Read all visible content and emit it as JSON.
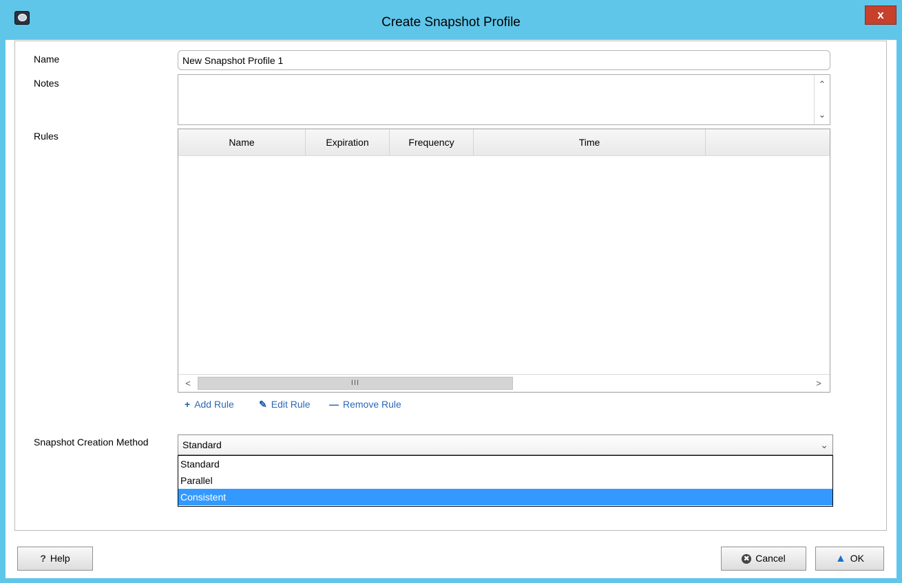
{
  "window": {
    "title": "Create Snapshot Profile",
    "close_label": "x"
  },
  "form": {
    "name_label": "Name",
    "name_value": "New Snapshot Profile 1",
    "notes_label": "Notes",
    "notes_value": "",
    "rules_label": "Rules",
    "method_label": "Snapshot Creation Method"
  },
  "rules_table": {
    "columns": [
      "Name",
      "Expiration",
      "Frequency",
      "Time"
    ],
    "rows": [],
    "hscroll_thumb": "III"
  },
  "rule_actions": {
    "add": "Add Rule",
    "edit": "Edit Rule",
    "remove": "Remove Rule"
  },
  "method_combo": {
    "selected": "Standard",
    "options": [
      "Standard",
      "Parallel",
      "Consistent"
    ],
    "highlighted_option": "Consistent"
  },
  "footer": {
    "help_label": "Help",
    "cancel_label": "Cancel",
    "ok_label": "OK"
  },
  "colors": {
    "titlebar": "#5fc6ea",
    "close_button": "#c7402c",
    "selection": "#3399ff",
    "link": "#2a68b8"
  }
}
